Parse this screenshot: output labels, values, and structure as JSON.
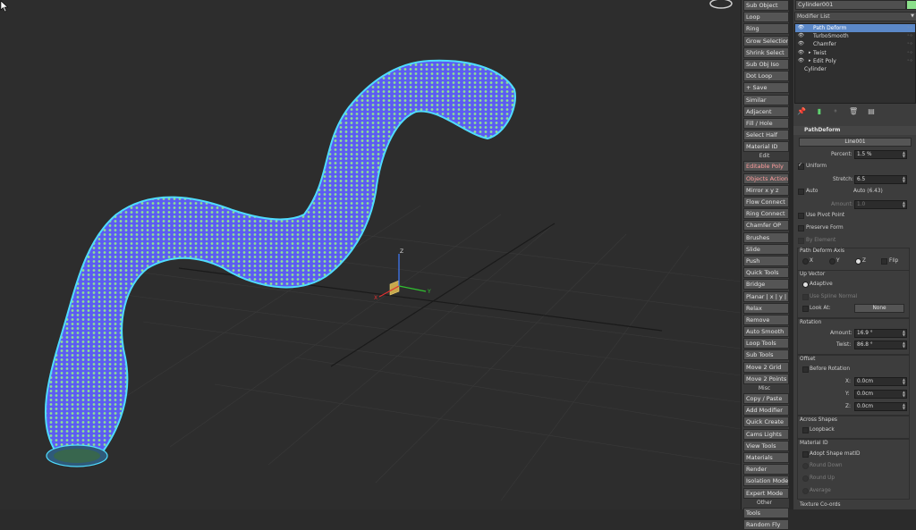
{
  "quad_menu": {
    "items": [
      {
        "label": "Sub Object",
        "color": "n"
      },
      {
        "label": "Loop",
        "color": "n"
      },
      {
        "label": "Ring",
        "color": "n"
      },
      {
        "label": "Grow Selection",
        "color": "n"
      },
      {
        "label": "Shrink Select",
        "color": "n"
      },
      {
        "label": "Sub Obj Iso",
        "color": "n"
      },
      {
        "label": "Dot Loop",
        "color": "n"
      },
      {
        "label": "+ Save",
        "color": "n"
      },
      {
        "label": "Similar",
        "color": "n"
      },
      {
        "label": "Adjacent",
        "color": "n"
      },
      {
        "label": "Fill / Hole",
        "color": "n"
      },
      {
        "label": "Select Half",
        "color": "n"
      },
      {
        "label": "Material ID",
        "color": "n"
      },
      {
        "label": "Edit",
        "header": true
      },
      {
        "label": "Editable Poly",
        "color": "r"
      },
      {
        "label": "Objects Actions",
        "color": "r"
      },
      {
        "label": "Mirror  x  y  z",
        "color": "n"
      },
      {
        "label": "Flow Connect",
        "color": "n"
      },
      {
        "label": "Ring Connect",
        "color": "n"
      },
      {
        "label": "Chamfer OP",
        "color": "n"
      },
      {
        "label": "Brushes",
        "color": "n"
      },
      {
        "label": "Slide",
        "color": "n"
      },
      {
        "label": "Push",
        "color": "n"
      },
      {
        "label": "Quick Tools",
        "color": "n"
      },
      {
        "label": "Bridge",
        "color": "n"
      },
      {
        "label": "Planar | x | y | z",
        "color": "n"
      },
      {
        "label": "Relax",
        "color": "n"
      },
      {
        "label": "Remove",
        "color": "n"
      },
      {
        "label": "Auto Smooth",
        "color": "n"
      },
      {
        "label": "Loop Tools",
        "color": "n"
      },
      {
        "label": "Sub Tools",
        "color": "n"
      },
      {
        "label": "Move 2 Grid",
        "color": "n"
      },
      {
        "label": "Move 2 Points",
        "color": "n"
      },
      {
        "label": "Misc",
        "header": true
      },
      {
        "label": "Copy / Paste",
        "color": "n"
      },
      {
        "label": "Add Modifier",
        "color": "n"
      },
      {
        "label": "Quick Create",
        "color": "n"
      },
      {
        "label": "Cams Lights",
        "color": "n"
      },
      {
        "label": "View Tools",
        "color": "n"
      },
      {
        "label": "Materials",
        "color": "n"
      },
      {
        "label": "Render",
        "color": "n"
      },
      {
        "label": "Isolation Mode",
        "color": "n"
      },
      {
        "label": "Expert Mode",
        "color": "n"
      },
      {
        "label": "Other",
        "header": true
      },
      {
        "label": "Tools",
        "color": "n"
      },
      {
        "label": "Random Fly",
        "color": "n"
      }
    ]
  },
  "panel": {
    "object_name": "Cylinder001",
    "object_color": "#8be08b",
    "modifier_list": "Modifier List",
    "stack": [
      {
        "label": "Path Deform",
        "selected": true,
        "eye": true,
        "tri": false
      },
      {
        "label": "TurboSmooth",
        "selected": false,
        "eye": true,
        "tri": false
      },
      {
        "label": "Chamfer",
        "selected": false,
        "eye": true,
        "tri": false
      },
      {
        "label": "Twist",
        "selected": false,
        "eye": true,
        "tri": true
      },
      {
        "label": "Edit Poly",
        "selected": false,
        "eye": true,
        "tri": true
      },
      {
        "label": "Cylinder",
        "selected": false,
        "eye": false,
        "tri": false
      }
    ],
    "rollout_title": "PathDeform",
    "path_button": "Line001",
    "percent_label": "Percent:",
    "percent_value": "1.5 %",
    "uniform_label": "Uniform",
    "stretch_label": "Stretch:",
    "stretch_value": "6.5",
    "auto_label": "Auto",
    "auto_value": "Auto (6.43)",
    "amount_label": "Amount:",
    "amount_value": "1.0",
    "use_pivot_label": "Use Pivot Point",
    "preserve_form_label": "Preserve Form",
    "by_element_label": "By Element",
    "axis_title": "Path Deform Axis",
    "axis_x": "X",
    "axis_y": "Y",
    "axis_z": "Z",
    "flip_label": "Flip",
    "up_vector_title": "Up Vector",
    "adaptive_label": "Adaptive",
    "use_spline_normal_label": "Use Spline Normal",
    "look_at_label": "Look At:",
    "none_button": "None",
    "rotation_title": "Rotation",
    "rot_amount_label": "Amount:",
    "rot_amount_value": "16.9 °",
    "twist_label": "Twist:",
    "twist_value": "86.8 °",
    "offset_title": "Offset",
    "before_rotation_label": "Before Rotation",
    "x_label": "X:",
    "x_value": "0.0cm",
    "y_label": "Y:",
    "y_value": "0.0cm",
    "z_label": "Z:",
    "z_value": "0.0cm",
    "across_shapes_title": "Across Shapes",
    "loopback_label": "Loopback",
    "material_id_title": "Material ID",
    "adopt_label": "Adopt Shape matID",
    "round_down_label": "Round Down",
    "round_up_label": "Round Up",
    "average_label": "Average",
    "texture_coords_title": "Texture Co-ords"
  },
  "gizmo": {
    "z_label": "Z",
    "x_label": "X",
    "y_label": "Y"
  }
}
